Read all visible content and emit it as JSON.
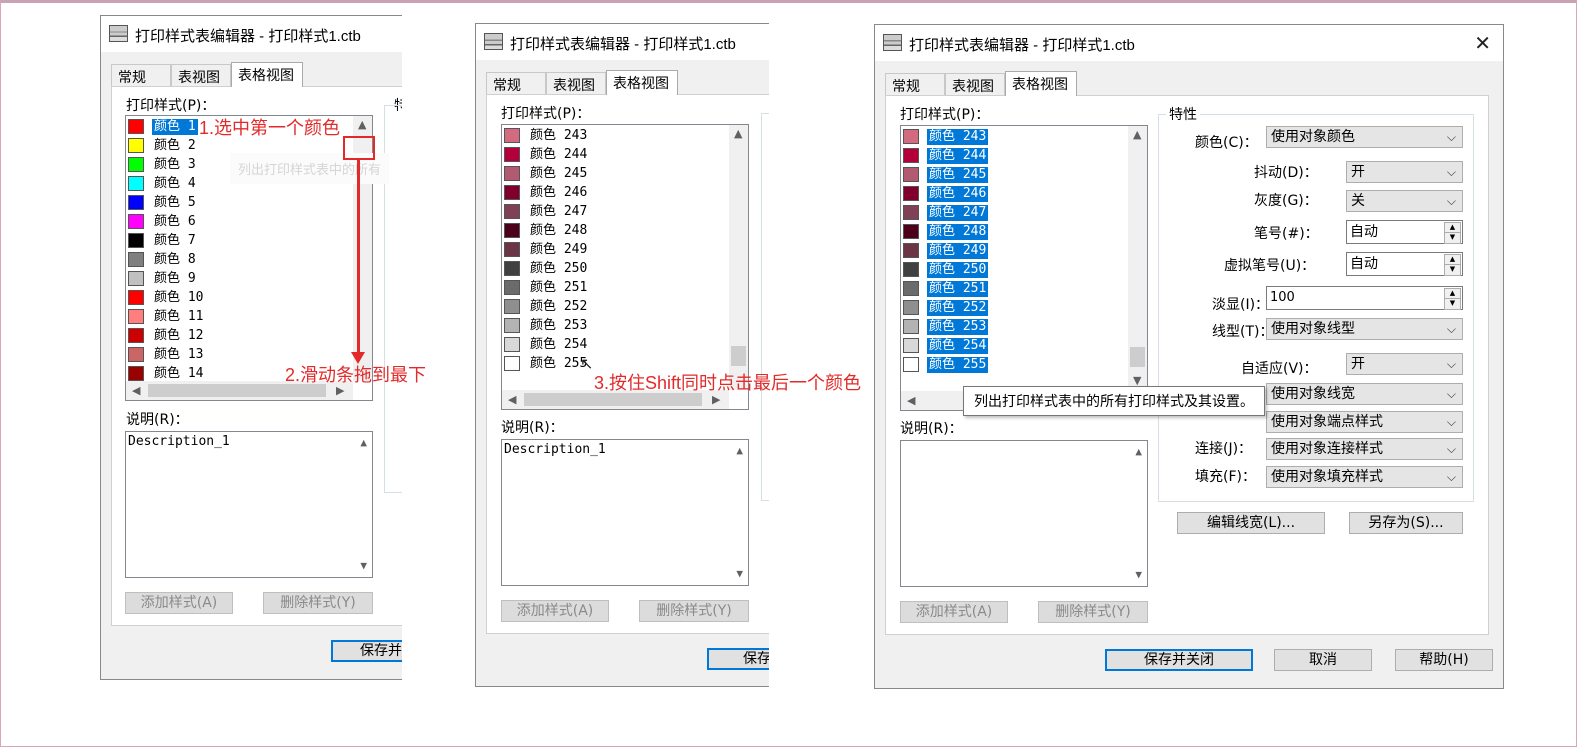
{
  "dialog_title": "打印样式表编辑器 - 打印样式1.ctb",
  "tabs": [
    "常规",
    "表视图",
    "表格视图"
  ],
  "print_style_label": "打印样式(P)：",
  "description_label": "说明(R)：",
  "description_value": "Description_1",
  "add_style_label": "添加样式(A)",
  "delete_style_label": "删除样式(Y)",
  "save_close_label": "保存并关闭",
  "save_close_partial": "保存并",
  "save_close_partial2": "保存",
  "cancel_label": "取消",
  "help_label": "帮助(H)",
  "edit_lineweight_label": "编辑线宽(L)...",
  "save_as_label": "另存为(S)...",
  "properties_label": "特性",
  "properties_partial": "特",
  "faded_hint": "列出打印样式表中的所有",
  "tooltip_text": "列出打印样式表中的所有打印样式及其设置。",
  "list1": [
    {
      "name": "颜色 1",
      "color": "#ff0000",
      "selected": true
    },
    {
      "name": "颜色 2",
      "color": "#ffff00"
    },
    {
      "name": "颜色 3",
      "color": "#00ff00"
    },
    {
      "name": "颜色 4",
      "color": "#00ffff"
    },
    {
      "name": "颜色 5",
      "color": "#0000ff"
    },
    {
      "name": "颜色 6",
      "color": "#ff00ff"
    },
    {
      "name": "颜色 7",
      "color": "#000000"
    },
    {
      "name": "颜色 8",
      "color": "#808080"
    },
    {
      "name": "颜色 9",
      "color": "#c0c0c0"
    },
    {
      "name": "颜色 10",
      "color": "#ff0000"
    },
    {
      "name": "颜色 11",
      "color": "#ff7f7f"
    },
    {
      "name": "颜色 12",
      "color": "#cc0000"
    },
    {
      "name": "颜色 13",
      "color": "#cc6666"
    },
    {
      "name": "颜色 14",
      "color": "#990000"
    }
  ],
  "list2": [
    {
      "name": "颜色 243",
      "color": "#d46a80"
    },
    {
      "name": "颜色 244",
      "color": "#b3003b"
    },
    {
      "name": "颜色 245",
      "color": "#b35a73"
    },
    {
      "name": "颜色 246",
      "color": "#80002b"
    },
    {
      "name": "颜色 247",
      "color": "#804055"
    },
    {
      "name": "颜色 248",
      "color": "#4d001a"
    },
    {
      "name": "颜色 249",
      "color": "#6b3545"
    },
    {
      "name": "颜色 250",
      "color": "#404040"
    },
    {
      "name": "颜色 251",
      "color": "#6b6b6b"
    },
    {
      "name": "颜色 252",
      "color": "#8f8f8f"
    },
    {
      "name": "颜色 253",
      "color": "#b3b3b3"
    },
    {
      "name": "颜色 254",
      "color": "#d8d8d8"
    },
    {
      "name": "颜色 255",
      "color": "#ffffff"
    }
  ],
  "props": {
    "color_label": "颜色(C)：",
    "color_value": "使用对象颜色",
    "dither_label": "抖动(D)：",
    "dither_value": "开",
    "gray_label": "灰度(G)：",
    "gray_value": "关",
    "pen_label": "笔号(#)：",
    "pen_value": "自动",
    "vpen_label": "虚拟笔号(U)：",
    "vpen_value": "自动",
    "screen_label": "淡显(I)：",
    "screen_value": "100",
    "linetype_label": "线型(T)：",
    "linetype_value": "使用对象线型",
    "adaptive_label": "自适应(V)：",
    "adaptive_value": "开",
    "lineweight_value": "使用对象线宽",
    "endstyle_value": "使用对象端点样式",
    "join_label": "连接(J)：",
    "join_value": "使用对象连接样式",
    "fill_label": "填充(F)：",
    "fill_value": "使用对象填充样式"
  },
  "annotations": {
    "step1": "1.选中第一个颜色",
    "step2": "2.滑动条拖到最下",
    "step3": "3.按住Shift同时点击最后一个颜色",
    "color": "#e32a2a"
  }
}
